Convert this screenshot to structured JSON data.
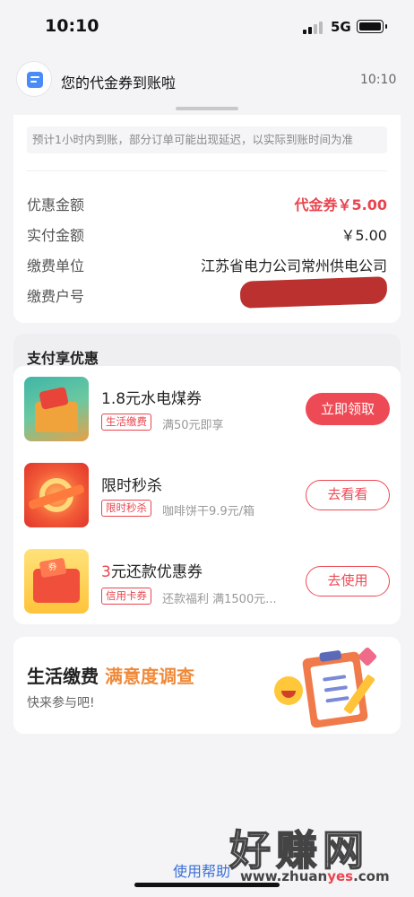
{
  "status_bar": {
    "time": "10:10",
    "network": "5G"
  },
  "notification": {
    "title": "您的代金券到账啦",
    "time": "10:10"
  },
  "notice": "预计1小时内到账，部分订单可能出现延迟，以实际到账时间为准",
  "details": [
    {
      "label": "优惠金额",
      "value": "代金券￥5.00"
    },
    {
      "label": "实付金额",
      "value": "￥5.00"
    },
    {
      "label": "缴费单位",
      "value": "江苏省电力公司常州供电公司"
    },
    {
      "label": "缴费户号",
      "value": ""
    }
  ],
  "promotions": {
    "title": "支付享优惠",
    "items": [
      {
        "title": "1.8元水电煤券",
        "tag": "生活缴费",
        "desc": "满50元即享",
        "button": "立即领取"
      },
      {
        "title": "限时秒杀",
        "tag": "限时秒杀",
        "desc": "咖啡饼干9.9元/箱",
        "button": "去看看"
      },
      {
        "title_accent": "3",
        "title_rest": "元还款优惠券",
        "tag": "信用卡券",
        "desc": "还款福利 满1500元...",
        "button": "去使用"
      }
    ]
  },
  "survey": {
    "title_a": "生活缴费",
    "title_b": "满意度调查",
    "subtitle": "快来参与吧!"
  },
  "help_link": "使用帮助",
  "watermark": {
    "text": "好赚网",
    "url_a": "www.zhuan",
    "url_b": "yes",
    "url_c": ".com"
  },
  "colors": {
    "accent": "#ee4a55",
    "link": "#3a6fd8",
    "survey_orange": "#f08a3a"
  }
}
